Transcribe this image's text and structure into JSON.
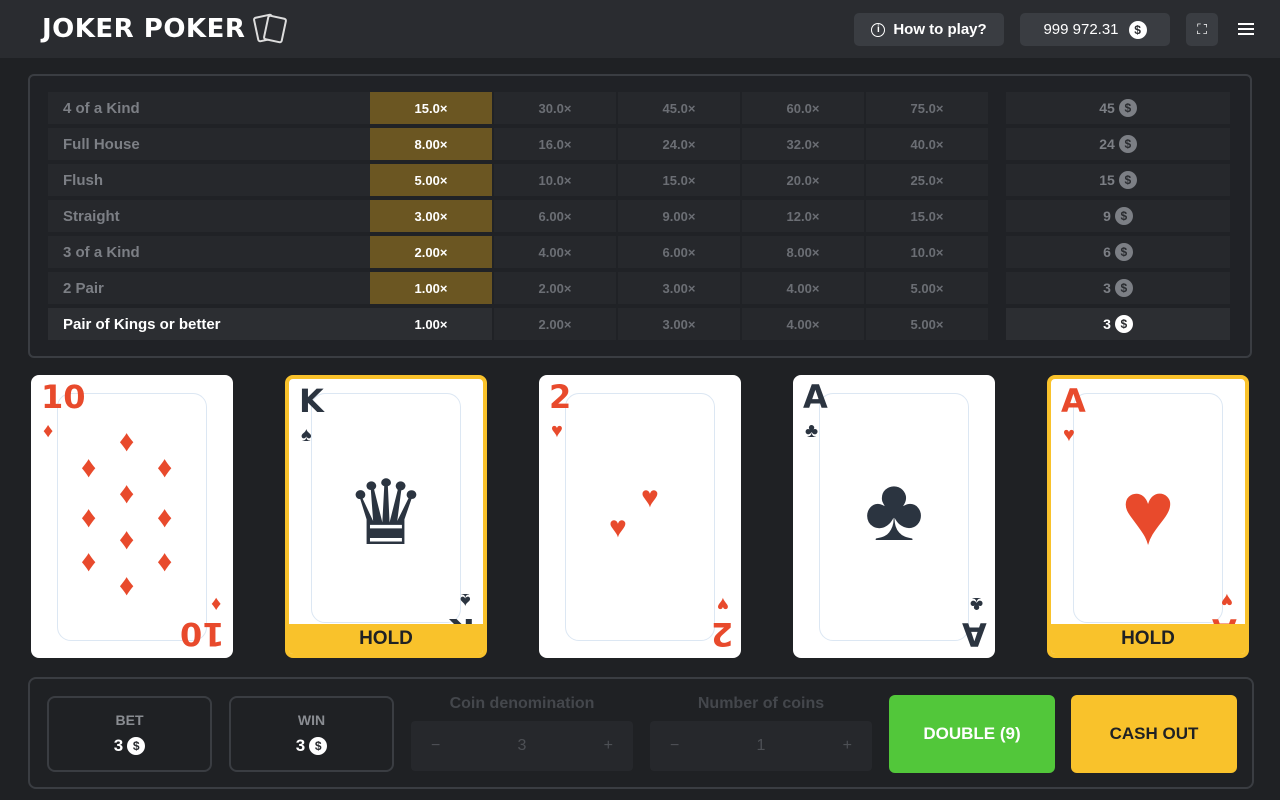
{
  "header": {
    "logo": "JOKER POKER",
    "how_to_play": "How to play?",
    "balance": "999 972.31"
  },
  "paytable": {
    "rows": [
      {
        "name": "4 of a Kind",
        "mults": [
          "15.0×",
          "30.0×",
          "45.0×",
          "60.0×",
          "75.0×"
        ],
        "coins": "45"
      },
      {
        "name": "Full House",
        "mults": [
          "8.00×",
          "16.0×",
          "24.0×",
          "32.0×",
          "40.0×"
        ],
        "coins": "24"
      },
      {
        "name": "Flush",
        "mults": [
          "5.00×",
          "10.0×",
          "15.0×",
          "20.0×",
          "25.0×"
        ],
        "coins": "15"
      },
      {
        "name": "Straight",
        "mults": [
          "3.00×",
          "6.00×",
          "9.00×",
          "12.0×",
          "15.0×"
        ],
        "coins": "9"
      },
      {
        "name": "3 of a Kind",
        "mults": [
          "2.00×",
          "4.00×",
          "6.00×",
          "8.00×",
          "10.0×"
        ],
        "coins": "6"
      },
      {
        "name": "2 Pair",
        "mults": [
          "1.00×",
          "2.00×",
          "3.00×",
          "4.00×",
          "5.00×"
        ],
        "coins": "3"
      },
      {
        "name": "Pair of Kings or better",
        "mults": [
          "1.00×",
          "2.00×",
          "3.00×",
          "4.00×",
          "5.00×"
        ],
        "coins": "3"
      }
    ]
  },
  "cards": [
    {
      "rank": "10",
      "suit": "♦",
      "color": "red",
      "held": false
    },
    {
      "rank": "K",
      "suit": "♠",
      "color": "dark",
      "held": true
    },
    {
      "rank": "2",
      "suit": "♥",
      "color": "red",
      "held": false
    },
    {
      "rank": "A",
      "suit": "♣",
      "color": "dark",
      "held": false
    },
    {
      "rank": "A",
      "suit": "♥",
      "color": "red",
      "held": true
    }
  ],
  "hold_label": "HOLD",
  "bottom": {
    "bet_label": "BET",
    "bet_value": "3",
    "win_label": "WIN",
    "win_value": "3",
    "coin_denom_label": "Coin denomination",
    "coin_denom_value": "3",
    "num_coins_label": "Number of coins",
    "num_coins_value": "1",
    "double_label": "DOUBLE (9)",
    "cashout_label": "CASH OUT"
  },
  "glyphs": {
    "minus": "−",
    "plus": "+",
    "coin": "$",
    "info": "i",
    "fullscreen": "⛶",
    "crown": "♛"
  }
}
